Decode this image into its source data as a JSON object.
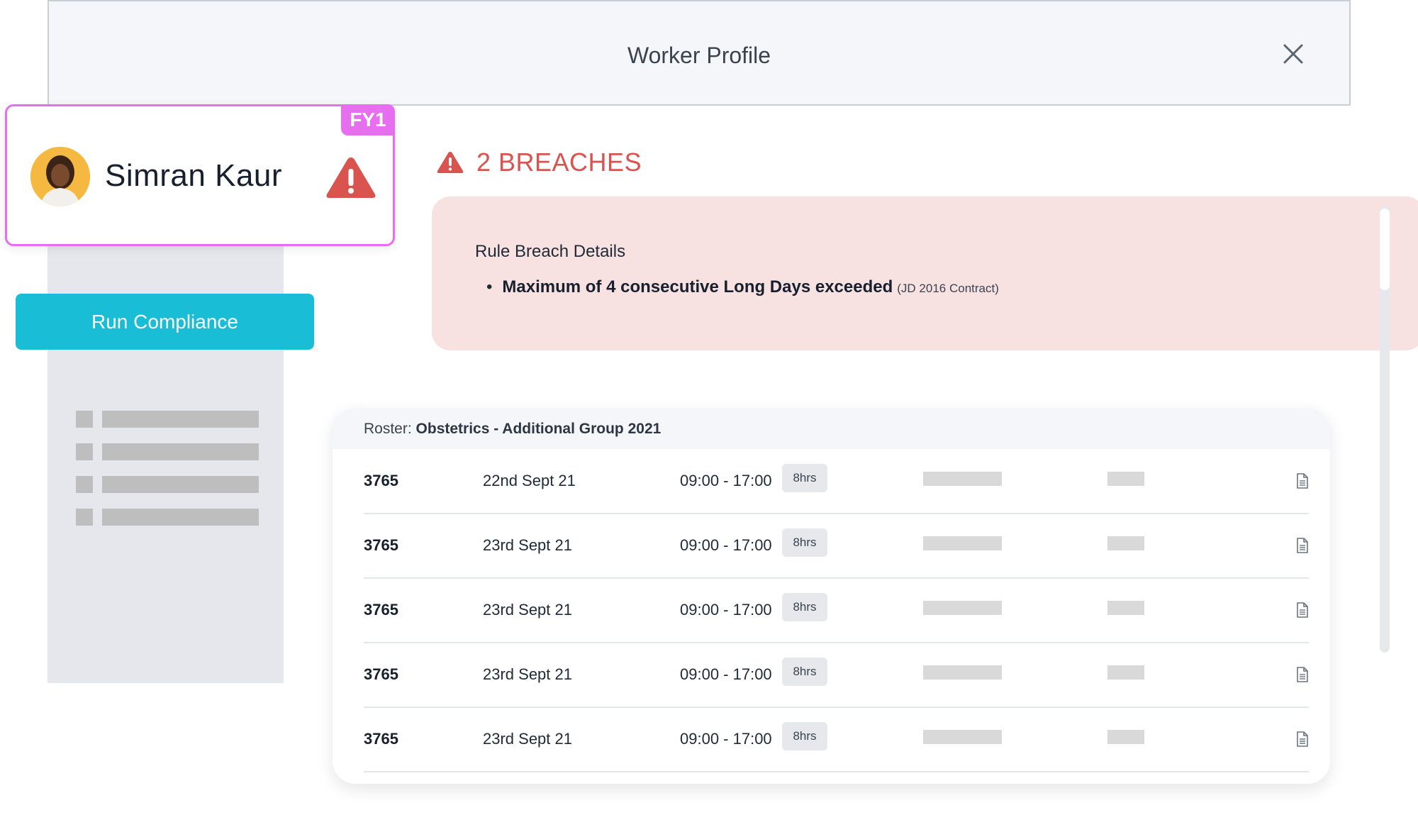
{
  "header": {
    "title": "Worker Profile",
    "close_icon": "close-icon"
  },
  "worker": {
    "name": "Simran Kaur",
    "grade": "FY1",
    "status_icon": "warning-icon",
    "avatar_icon": "avatar"
  },
  "sidebar": {
    "run_compliance_label": "Run Compliance"
  },
  "breaches": {
    "heading": "2 BREACHES",
    "details_title": "Rule Breach Details",
    "items": [
      {
        "bullet": "•",
        "rule": "Maximum of 4 consecutive Long Days exceeded",
        "contract": "(JD 2016 Contract)"
      }
    ]
  },
  "roster": {
    "label_prefix": "Roster:",
    "name": "Obstetrics - Additional Group 2021",
    "rows": [
      {
        "id": "3765",
        "date": "22nd Sept 21",
        "time": "09:00 - 17:00",
        "hours": "8hrs"
      },
      {
        "id": "3765",
        "date": "23rd Sept 21",
        "time": "09:00 - 17:00",
        "hours": "8hrs"
      },
      {
        "id": "3765",
        "date": "23rd Sept 21",
        "time": "09:00 - 17:00",
        "hours": "8hrs"
      },
      {
        "id": "3765",
        "date": "23rd Sept 21",
        "time": "09:00 - 17:00",
        "hours": "8hrs"
      },
      {
        "id": "3765",
        "date": "23rd Sept 21",
        "time": "09:00 - 17:00",
        "hours": "8hrs"
      }
    ]
  },
  "colors": {
    "accent_pink": "#e86ef0",
    "button_cyan": "#1abdd6",
    "breach_red": "#d9534f",
    "breach_bg": "#f8e1e1"
  }
}
